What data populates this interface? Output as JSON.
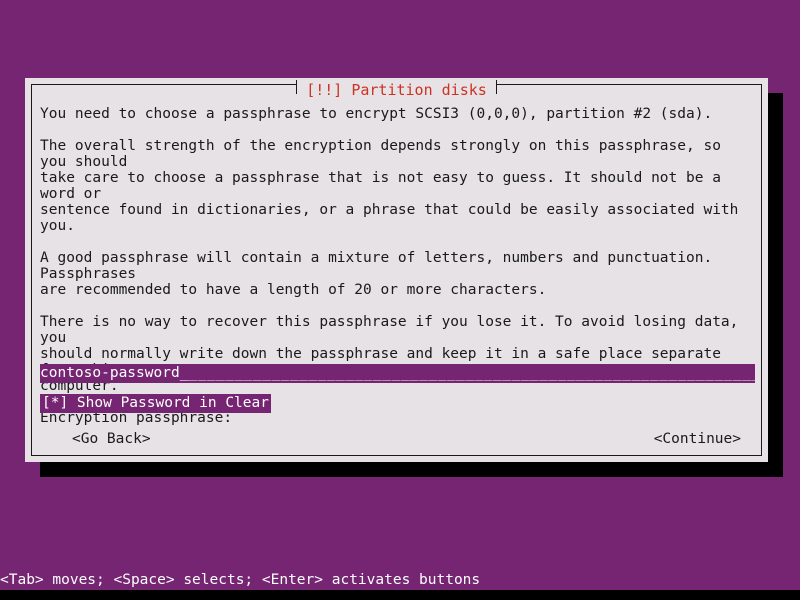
{
  "screen": {
    "background_color": "#762572",
    "shadow_color": "#000000"
  },
  "dialog": {
    "title": "[!!] Partition disks",
    "title_color": "#cc3322",
    "panel_color": "#e6e2e6",
    "border_color": "#1a1a1a",
    "paragraphs": [
      "You need to choose a passphrase to encrypt SCSI3 (0,0,0), partition #2 (sda).",
      "The overall strength of the encryption depends strongly on this passphrase, so you should\ntake care to choose a passphrase that is not easy to guess. It should not be a word or\nsentence found in dictionaries, or a phrase that could be easily associated with you.",
      "A good passphrase will contain a mixture of letters, numbers and punctuation. Passphrases\nare recommended to have a length of 20 or more characters.",
      "There is no way to recover this passphrase if you lose it. To avoid losing data, you\nshould normally write down the passphrase and keep it in a safe place separate from this\ncomputer."
    ],
    "field_label": "Encryption passphrase:",
    "passphrase": {
      "value": "contoso-password",
      "cursor": "_",
      "filler": "________________________________________________________________",
      "field_color": "#762572",
      "text_color": "#ffffff"
    },
    "show_password_checkbox": {
      "label": "[*] Show Password in Clear",
      "checked": true,
      "highlight_color": "#762572",
      "text_color": "#ffffff"
    },
    "buttons": {
      "go_back": "<Go Back>",
      "continue": "<Continue>"
    }
  },
  "statusbar": {
    "text": "<Tab> moves; <Space> selects; <Enter> activates buttons",
    "background_color": "#762572",
    "text_color": "#ffffff"
  }
}
